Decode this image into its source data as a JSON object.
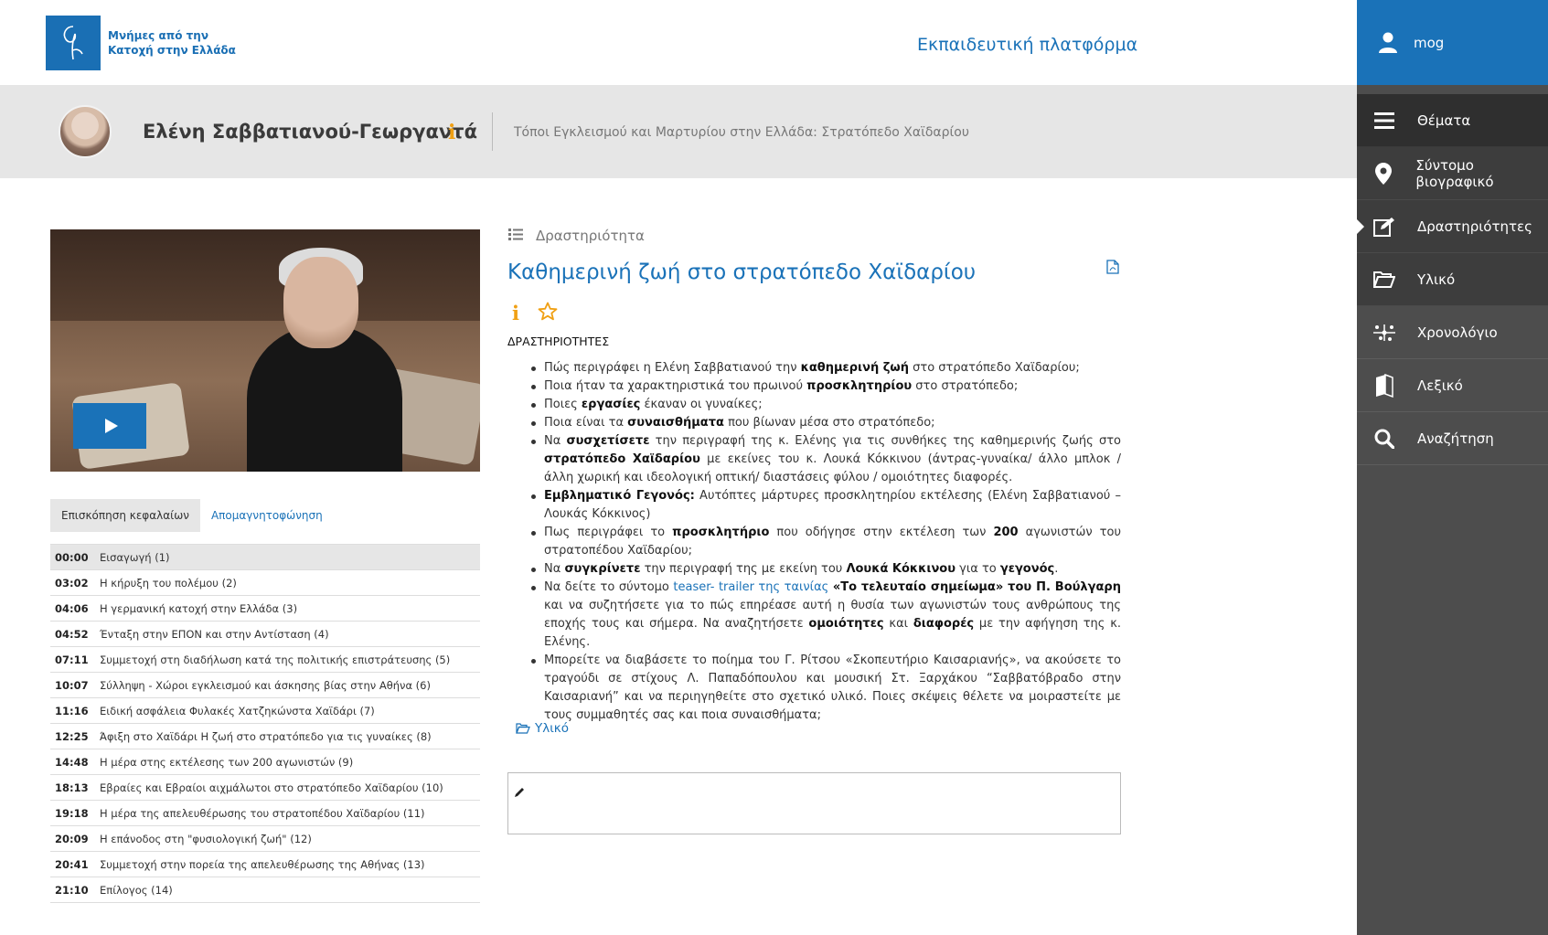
{
  "header": {
    "logo_text": "Μνήμες από την Κατοχή στην Ελλάδα",
    "platform_title": "Εκπαιδευτική πλατφόρμα"
  },
  "person": {
    "name": "Ελένη Σαββατιανού-Γεωργαντά",
    "info_symbol": "i",
    "location": "Τόποι Εγκλεισμού και Μαρτυρίου στην Ελλάδα: Στρατόπεδο Χαϊδαρίου"
  },
  "sidebar": {
    "user": "mog",
    "items": [
      {
        "label": "Θέματα",
        "icon": "menu-icon"
      },
      {
        "label": "Σύντομο βιογραφικό",
        "icon": "map-pin-icon"
      },
      {
        "label": "Δραστηριότητες",
        "icon": "edit-icon"
      },
      {
        "label": "Υλικό",
        "icon": "folder-open-icon"
      },
      {
        "label": "Χρονολόγιο",
        "icon": "timeline-icon"
      },
      {
        "label": "Λεξικό",
        "icon": "book-icon"
      },
      {
        "label": "Αναζήτηση",
        "icon": "search-icon"
      }
    ]
  },
  "video": {
    "play_icon": "play-icon"
  },
  "tabs": {
    "overview": "Επισκόπηση κεφαλαίων",
    "transcript": "Απομαγνητοφώνηση"
  },
  "chapters": [
    {
      "time": "00:00",
      "title": "Εισαγωγή (1)"
    },
    {
      "time": "03:02",
      "title": "Η κήρυξη του πολέμου (2)"
    },
    {
      "time": "04:06",
      "title": "Η γερμανική κατοχή στην Ελλάδα (3)"
    },
    {
      "time": "04:52",
      "title": "Ένταξη στην ΕΠΟΝ και στην Αντίσταση (4)"
    },
    {
      "time": "07:11",
      "title": "Συμμετοχή στη διαδήλωση κατά της πολιτικής επιστράτευσης (5)"
    },
    {
      "time": "10:07",
      "title": "Σύλληψη - Χώροι εγκλεισμού και άσκησης βίας στην Αθήνα (6)"
    },
    {
      "time": "11:16",
      "title": "Ειδική ασφάλεια Φυλακές Χατζηκώνστα Χαϊδάρι (7)"
    },
    {
      "time": "12:25",
      "title": "Άφιξη στο Χαϊδάρι Η ζωή στο στρατόπεδο για τις γυναίκες (8)"
    },
    {
      "time": "14:48",
      "title": "Η μέρα στης εκτέλεσης των 200 αγωνιστών (9)"
    },
    {
      "time": "18:13",
      "title": "Εβραίες και Εβραίοι αιχμάλωτοι στο στρατόπεδο Χαϊδαρίου (10)"
    },
    {
      "time": "19:18",
      "title": "Η μέρα της απελευθέρωσης του στρατοπέδου Χαϊδαρίου (11)"
    },
    {
      "time": "20:09",
      "title": "Η επάνοδος στη \"φυσιολογική ζωή\" (12)"
    },
    {
      "time": "20:41",
      "title": "Συμμετοχή στην πορεία της απελευθέρωσης της Αθήνας (13)"
    },
    {
      "time": "21:10",
      "title": "Επίλογος (14)"
    }
  ],
  "activity": {
    "section_label": "Δραστηριότητα",
    "title": "Καθημερινή ζωή στο στρατόπεδο Χαϊδαρίου",
    "info_symbol": "i",
    "activities_label": "ΔΡΑΣΤΗΡΙΟΤΗΤΕΣ",
    "items": [
      [
        {
          "t": "Πώς περιγράφει η  Ελένη Σαββατιανού την "
        },
        {
          "t": "καθημερινή ζωή",
          "b": true
        },
        {
          "t": " στο στρατόπεδο Χαϊδαρίου;"
        }
      ],
      [
        {
          "t": "Ποια ήταν τα χαρακτηριστικά του πρωινού "
        },
        {
          "t": "προσκλητηρίου",
          "b": true
        },
        {
          "t": " στο στρατόπεδο;"
        }
      ],
      [
        {
          "t": "Ποιες "
        },
        {
          "t": "εργασίες",
          "b": true
        },
        {
          "t": " έκαναν οι γυναίκες;"
        }
      ],
      [
        {
          "t": "Ποια είναι τα "
        },
        {
          "t": "συναισθήματα",
          "b": true
        },
        {
          "t": " που βίωναν μέσα στο στρατόπεδο;"
        }
      ],
      [
        {
          "t": "Να "
        },
        {
          "t": "συσχετίσετε",
          "b": true
        },
        {
          "t": " την περιγραφή της κ. Ελένης για τις συνθήκες της καθημερινής ζωής στο "
        },
        {
          "t": "στρατόπεδο Χαϊδαρίου",
          "b": true
        },
        {
          "t": " με εκείνες του κ. Λουκά Κόκκινου (άντρας-γυναίκα/ άλλο μπλοκ / άλλη χωρική και ιδεολογική οπτική/ διαστάσεις φύλου / ομοιότητες διαφορές."
        }
      ],
      [
        {
          "t": "Εμβληματικό Γεγονός:",
          "b": true
        },
        {
          "t": " Αυτόπτες μάρτυρες προσκλητηρίου εκτέλεσης (Ελένη Σαββατιανού – Λουκάς Κόκκινος)"
        }
      ],
      [
        {
          "t": "Πως περιγράφει το "
        },
        {
          "t": "προσκλητήριο",
          "b": true
        },
        {
          "t": " που οδήγησε στην εκτέλεση των "
        },
        {
          "t": "200",
          "b": true
        },
        {
          "t": " αγωνιστών του στρατοπέδου Χαϊδαρίου;"
        }
      ],
      [
        {
          "t": "Να "
        },
        {
          "t": "συγκρίνετε",
          "b": true
        },
        {
          "t": " την περιγραφή της με εκείνη του "
        },
        {
          "t": "Λουκά Κόκκινου",
          "b": true
        },
        {
          "t": " για το "
        },
        {
          "t": "γεγονός",
          "b": true
        },
        {
          "t": "."
        }
      ],
      [
        {
          "t": "Να δείτε το σύντομο "
        },
        {
          "t": "teaser- trailer της ταινίας",
          "l": true
        },
        {
          "t": " "
        },
        {
          "t": "«Το τελευταίο σημείωμα» του Π. Βούλγαρη",
          "b": true
        },
        {
          "t": " και να συζητήσετε για το πώς επηρέασε αυτή η θυσία των αγωνιστών τους ανθρώπους της εποχής τους και σήμερα.  Να αναζητήσετε "
        },
        {
          "t": "ομοιότητες",
          "b": true
        },
        {
          "t": " και "
        },
        {
          "t": "διαφορές",
          "b": true
        },
        {
          "t": " με την αφήγηση της κ. Ελένης."
        }
      ],
      [
        {
          "t": "Μπορείτε να διαβάσετε το ποίημα του Γ. Ρίτσου «Σκοπευτήριο Καισαριανής», να ακούσετε το τραγούδι σε στίχους Λ. Παπαδόπουλου και μουσική Στ. Ξαρχάκου “Σαββατόβραδο στην Καισαριανή” και να περιηγηθείτε στο σχετικό υλικό. Ποιες σκέψεις θέλετε να μοιραστείτε με τους συμμαθητές σας και ποια συναισθήματα;"
        }
      ]
    ],
    "material_link": "Υλικό"
  },
  "colors": {
    "brand_blue": "#1a72b8",
    "accent_orange": "#f0a014",
    "sidebar_bg": "#4d4d4d"
  }
}
